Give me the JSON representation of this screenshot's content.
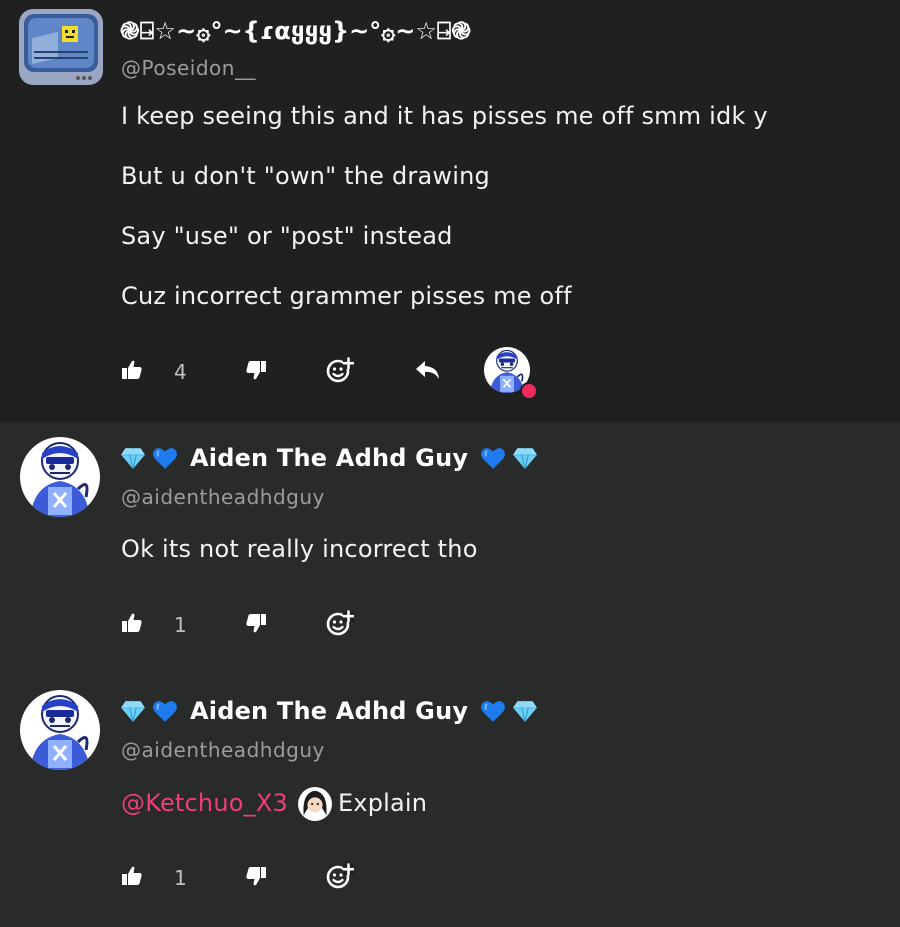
{
  "comments": [
    {
      "author": "֎⍈☆~۞°~{ɾαყყყ}~°۞~☆⍈֎",
      "handle": "@Poseidon__",
      "lines": [
        "I keep seeing this and it has pisses me off smm idk y",
        "But u don't \"own\" the drawing",
        "Say \"use\" or \"post\" instead",
        "Cuz incorrect grammer pisses me off"
      ],
      "likes": "4"
    },
    {
      "author": "Aiden The Adhd Guy",
      "handle": "@aidentheadhdguy",
      "lines": [
        "Ok its not really incorrect tho"
      ],
      "likes": "1"
    },
    {
      "author": "Aiden The Adhd Guy",
      "handle": "@aidentheadhdguy",
      "mention": "@Ketchuo_X3",
      "text": "Explain",
      "likes": "1"
    }
  ],
  "icons": {
    "like": "thumbs-up-icon",
    "dislike": "thumbs-down-icon",
    "react": "add-reaction-icon",
    "reply": "reply-arrow-icon"
  },
  "colors": {
    "mention": "#ee3f74",
    "heart": "#1e7cf0",
    "gem": "#6ecff6"
  }
}
